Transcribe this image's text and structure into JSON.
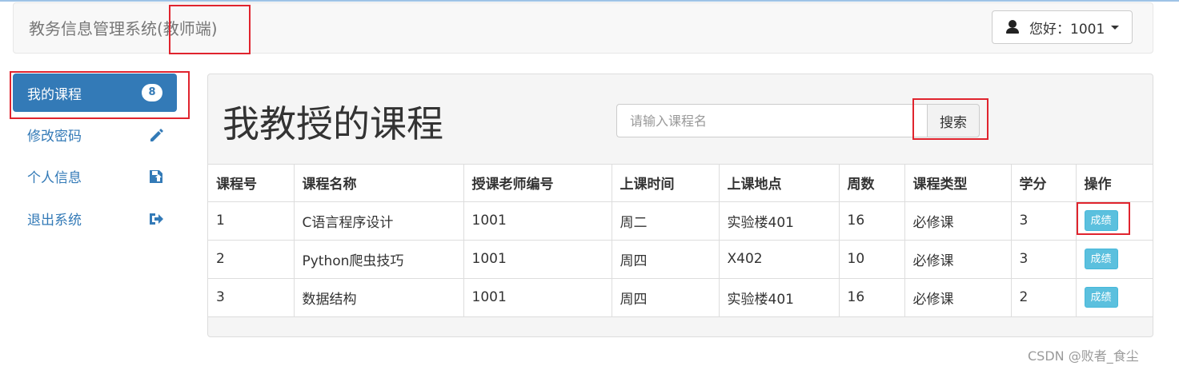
{
  "header": {
    "brand": "教务信息管理系统",
    "brand_suffix": "(教师端)",
    "user_greeting": "您好：1001"
  },
  "sidebar": {
    "items": [
      {
        "label": "我的课程",
        "badge": "8",
        "icon": "",
        "active": true
      },
      {
        "label": "修改密码",
        "badge": "",
        "icon": "pencil-icon",
        "active": false
      },
      {
        "label": "个人信息",
        "badge": "",
        "icon": "save-icon",
        "active": false
      },
      {
        "label": "退出系统",
        "badge": "",
        "icon": "logout-icon",
        "active": false
      }
    ]
  },
  "main": {
    "title": "我教授的课程",
    "search": {
      "placeholder": "请输入课程名",
      "value": "",
      "button_label": "搜索"
    },
    "table": {
      "headers": [
        "课程号",
        "课程名称",
        "授课老师编号",
        "上课时间",
        "上课地点",
        "周数",
        "课程类型",
        "学分",
        "操作"
      ],
      "rows": [
        {
          "id": "1",
          "name": "C语言程序设计",
          "teacher_id": "1001",
          "time": "周二",
          "location": "实验楼401",
          "weeks": "16",
          "type": "必修课",
          "credit": "3",
          "action": "成绩"
        },
        {
          "id": "2",
          "name": "Python爬虫技巧",
          "teacher_id": "1001",
          "time": "周四",
          "location": "X402",
          "weeks": "10",
          "type": "必修课",
          "credit": "3",
          "action": "成绩"
        },
        {
          "id": "3",
          "name": "数据结构",
          "teacher_id": "1001",
          "time": "周四",
          "location": "实验楼401",
          "weeks": "16",
          "type": "必修课",
          "credit": "2",
          "action": "成绩"
        }
      ]
    }
  },
  "watermark": "CSDN @败者_食尘",
  "colors": {
    "primary": "#337ab7",
    "info": "#5bc0de",
    "highlight": "#e0242e"
  }
}
